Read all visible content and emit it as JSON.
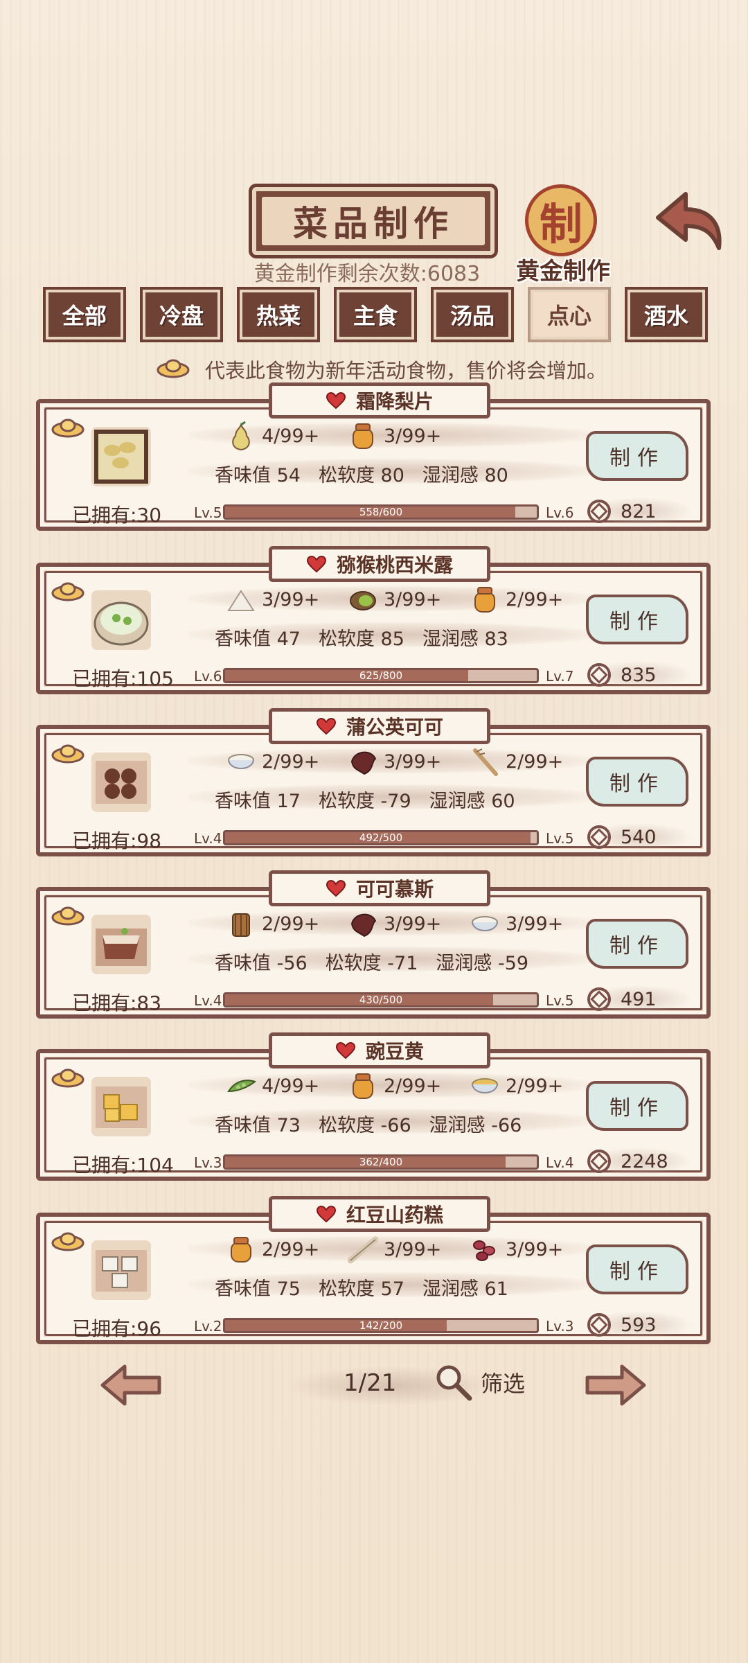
{
  "header": {
    "title": "菜品制作",
    "remaining": "黄金制作剩余次数:6083",
    "seal_char": "制",
    "gold_label": "黄金制作"
  },
  "tabs": [
    "全部",
    "冷盘",
    "热菜",
    "主食",
    "汤品",
    "点心",
    "酒水"
  ],
  "active_tab": "点心",
  "notice": "代表此食物为新年活动食物，售价将会增加。",
  "recipes": [
    {
      "name": "霜降梨片",
      "owned": "已拥有:30",
      "ingredients": [
        {
          "icon": "pear-icon",
          "count": "4/99+"
        },
        {
          "icon": "honey-jar-icon",
          "count": "3/99+"
        }
      ],
      "stats": {
        "aroma": "香味值 54",
        "softness": "松软度 80",
        "moisture": "湿润感 80"
      },
      "lv_from": "Lv.5",
      "lv_to": "Lv.6",
      "progress_text": "558/600",
      "progress": 0.93,
      "make": "制作",
      "price": "821"
    },
    {
      "name": "猕猴桃西米露",
      "owned": "已拥有:105",
      "ingredients": [
        {
          "icon": "sugar-pile-icon",
          "count": "3/99+"
        },
        {
          "icon": "kiwi-icon",
          "count": "3/99+"
        },
        {
          "icon": "honey-jar-icon",
          "count": "2/99+"
        }
      ],
      "stats": {
        "aroma": "香味值 47",
        "softness": "松软度 85",
        "moisture": "湿润感 83"
      },
      "lv_from": "Lv.6",
      "lv_to": "Lv.7",
      "progress_text": "625/800",
      "progress": 0.78,
      "make": "制作",
      "price": "835"
    },
    {
      "name": "蒲公英可可",
      "owned": "已拥有:98",
      "ingredients": [
        {
          "icon": "rice-bowl-icon",
          "count": "2/99+"
        },
        {
          "icon": "cocoa-leaf-icon",
          "count": "3/99+"
        },
        {
          "icon": "dandelion-root-icon",
          "count": "2/99+"
        }
      ],
      "stats": {
        "aroma": "香味值 17",
        "softness": "松软度 -79",
        "moisture": "湿润感 60"
      },
      "lv_from": "Lv.4",
      "lv_to": "Lv.5",
      "progress_text": "492/500",
      "progress": 0.98,
      "make": "制作",
      "price": "540"
    },
    {
      "name": "可可慕斯",
      "owned": "已拥有:83",
      "ingredients": [
        {
          "icon": "cup-icon",
          "count": "2/99+"
        },
        {
          "icon": "cocoa-leaf-icon",
          "count": "3/99+"
        },
        {
          "icon": "rice-bowl-icon",
          "count": "3/99+"
        }
      ],
      "stats": {
        "aroma": "香味值 -56",
        "softness": "松软度 -71",
        "moisture": "湿润感 -59"
      },
      "lv_from": "Lv.4",
      "lv_to": "Lv.5",
      "progress_text": "430/500",
      "progress": 0.86,
      "make": "制作",
      "price": "491"
    },
    {
      "name": "豌豆黄",
      "owned": "已拥有:104",
      "ingredients": [
        {
          "icon": "pea-pod-icon",
          "count": "4/99+"
        },
        {
          "icon": "honey-jar-icon",
          "count": "2/99+"
        },
        {
          "icon": "grain-bowl-icon",
          "count": "2/99+"
        }
      ],
      "stats": {
        "aroma": "香味值 73",
        "softness": "松软度 -66",
        "moisture": "湿润感 -66"
      },
      "lv_from": "Lv.3",
      "lv_to": "Lv.4",
      "progress_text": "362/400",
      "progress": 0.9,
      "make": "制作",
      "price": "2248"
    },
    {
      "name": "红豆山药糕",
      "owned": "已拥有:96",
      "ingredients": [
        {
          "icon": "honey-jar-icon",
          "count": "2/99+"
        },
        {
          "icon": "yam-icon",
          "count": "3/99+"
        },
        {
          "icon": "red-bean-icon",
          "count": "3/99+"
        }
      ],
      "stats": {
        "aroma": "香味值 75",
        "softness": "松软度 57",
        "moisture": "湿润感 61"
      },
      "lv_from": "Lv.2",
      "lv_to": "Lv.3",
      "progress_text": "142/200",
      "progress": 0.71,
      "make": "制作",
      "price": "593"
    }
  ],
  "pager": {
    "page": "1/21",
    "filter": "筛选"
  },
  "colors": {
    "frame": "#7a5048",
    "tab_dark": "#6f4236",
    "button": "#dcebe6",
    "bar_fill": "#a56a5a"
  }
}
